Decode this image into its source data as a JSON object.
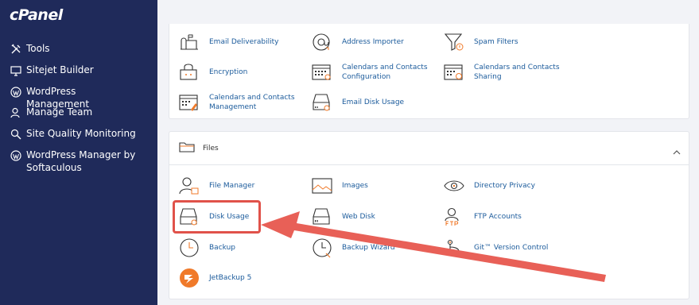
{
  "app": {
    "logo_text": "cPanel"
  },
  "sidebar": {
    "items": [
      {
        "label": "Tools",
        "icon": "tools-icon"
      },
      {
        "label": "Sitejet Builder",
        "icon": "monitor-icon"
      },
      {
        "label": "WordPress Management",
        "icon": "wordpress-icon"
      },
      {
        "label": "Manage Team",
        "icon": "user-icon"
      },
      {
        "label": "Site Quality Monitoring",
        "icon": "magnifier-icon"
      },
      {
        "label": "WordPress Manager by Softaculous",
        "icon": "wordpress-icon"
      }
    ]
  },
  "email_section": {
    "tools": [
      {
        "label": "Email Deliverability",
        "icon": "mailbox-icon"
      },
      {
        "label": "Address Importer",
        "icon": "at-sign-icon"
      },
      {
        "label": "Spam Filters",
        "icon": "funnel-icon"
      },
      {
        "label": "Encryption",
        "icon": "lock-box-icon"
      },
      {
        "label": "Calendars and Contacts Configuration",
        "icon": "calendar-icon"
      },
      {
        "label": "Calendars and Contacts Sharing",
        "icon": "calendar-share-icon"
      },
      {
        "label": "Calendars and Contacts Management",
        "icon": "calendar-edit-icon"
      },
      {
        "label": "Email Disk Usage",
        "icon": "disk-icon"
      }
    ]
  },
  "files_section": {
    "title": "Files",
    "tools": [
      {
        "label": "File Manager",
        "icon": "user-file-icon"
      },
      {
        "label": "Images",
        "icon": "image-icon"
      },
      {
        "label": "Directory Privacy",
        "icon": "eye-icon"
      },
      {
        "label": "Disk Usage",
        "icon": "disk-icon"
      },
      {
        "label": "Web Disk",
        "icon": "disk-icon"
      },
      {
        "label": "FTP Accounts",
        "icon": "ftp-user-icon"
      },
      {
        "label": "Backup",
        "icon": "clock-icon"
      },
      {
        "label": "Backup Wizard",
        "icon": "clock-wizard-icon"
      },
      {
        "label": "Git™ Version Control",
        "icon": "git-icon"
      },
      {
        "label": "JetBackup 5",
        "icon": "jetbackup-logo-icon"
      }
    ]
  },
  "colors": {
    "sidebar_bg": "#1f2a5a",
    "link": "#1a5a9b",
    "accent_orange": "#f07a2a",
    "annotation_red": "#e0524a"
  }
}
